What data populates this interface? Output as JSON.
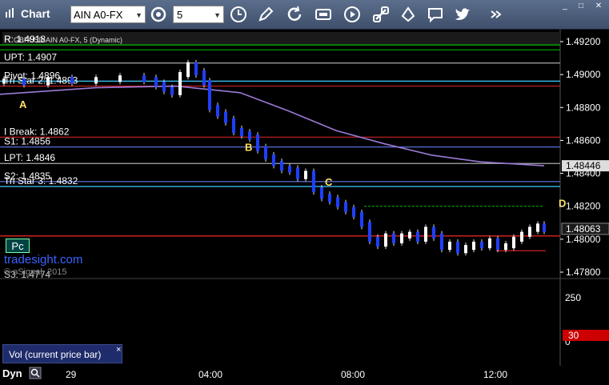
{
  "window": {
    "title": "Chart",
    "symbol": "AIN A0-FX",
    "interval": "5",
    "controls": [
      "_",
      "□",
      "✕"
    ]
  },
  "toolbar": [
    "interval-icon",
    "draw-icon",
    "refresh-icon",
    "get-icon",
    "play-icon",
    "link-icon",
    "chat-icon",
    "twitter-icon",
    "overflow-icon"
  ],
  "chart": {
    "legend_name": "R",
    "legend_text": "GBPUSD AIN A0-FX, 5 (Dynamic)",
    "pivots": [
      {
        "label": "R",
        "value": "1.4918",
        "price": 1.4918,
        "color": "#00c000"
      },
      {
        "label": "UPT: 1.4907",
        "value": "",
        "price": 1.4907,
        "color": "#aaaaaa"
      },
      {
        "label": "Pivot: 1.4896",
        "value": "",
        "price": 1.4896,
        "color": "#3ec8ff"
      },
      {
        "label": "Tri Star 2: 1.4893",
        "value": "",
        "price": 1.4893,
        "color": "#cc2222"
      },
      {
        "label": "I Break: 1.4862",
        "value": "",
        "price": 1.4862,
        "color": "#cc2222"
      },
      {
        "label": "S1: 1.4856",
        "value": "",
        "price": 1.4856,
        "color": "#5a6fd6"
      },
      {
        "label": "LPT: 1.4846",
        "value": "",
        "price": 1.4846,
        "color": "#aaaaaa"
      },
      {
        "label": "S2: 1.4835",
        "value": "",
        "price": 1.4835,
        "color": "#5a6fd6"
      },
      {
        "label": "Tri Star 3: 1.4832",
        "value": "",
        "price": 1.4832,
        "color": "#3ec8ff"
      },
      {
        "label": "S3: 1.4774",
        "value": "",
        "price": 1.4774,
        "color": "#aaaaaa"
      }
    ],
    "price_axis": [
      "1.49200",
      "1.49000",
      "1.48800",
      "1.48600",
      "1.48400",
      "1.48200",
      "1.48000",
      "1.47800"
    ],
    "price_labels": {
      "ma": "1.48446",
      "last": "1.48063"
    },
    "letters": [
      "A",
      "B",
      "C",
      "D"
    ],
    "watermark": "tradesight.com",
    "copyright": "© eSignal, 2015",
    "pc_button": "Pc"
  },
  "volume": {
    "axis": [
      "250",
      "0"
    ],
    "current": "30",
    "tab_label": "Vol (current price bar)",
    "tab_close": "×"
  },
  "time_axis": {
    "mode": "Dyn",
    "labels": [
      "29",
      "04:00",
      "08:00",
      "12:00"
    ]
  }
}
